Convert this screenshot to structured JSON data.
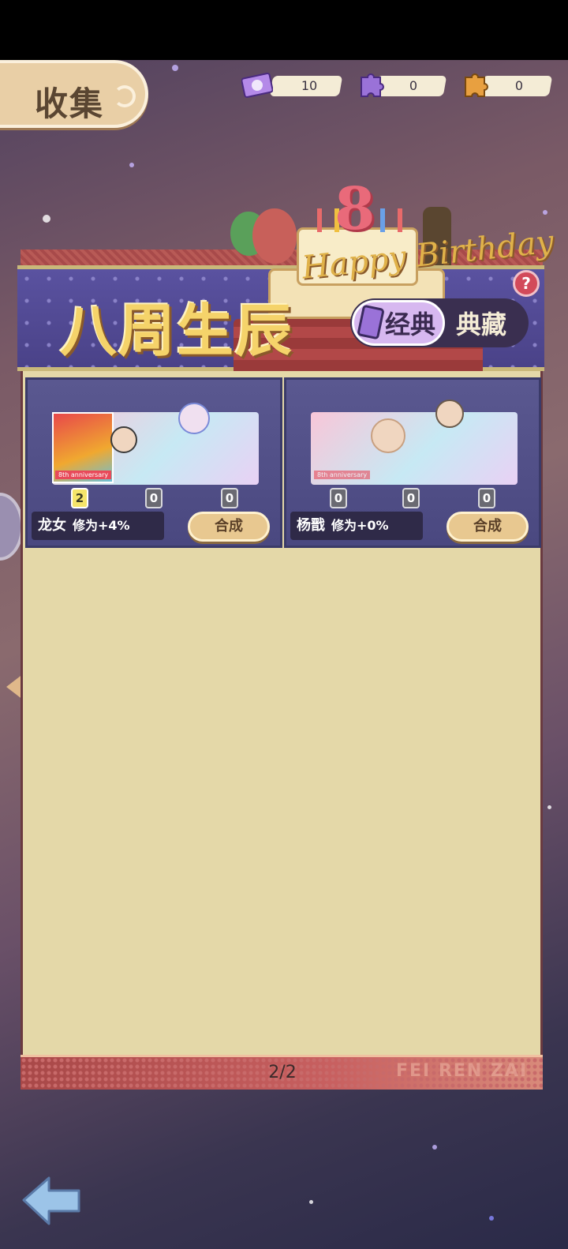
{
  "header": {
    "title": "收集"
  },
  "resources": [
    {
      "icon": "ticket-icon",
      "value": "10"
    },
    {
      "icon": "purple-puzzle-icon",
      "value": "0"
    },
    {
      "icon": "orange-puzzle-icon",
      "value": "0"
    }
  ],
  "banner": {
    "title": "八周生辰",
    "tabs": [
      "经典",
      "典藏"
    ],
    "selected_tab": "经典",
    "help_label": "?"
  },
  "cards": [
    {
      "name": "龙女",
      "bonus": "修为+4%",
      "counts": [
        "2",
        "0",
        "0"
      ],
      "owned_index": 0,
      "button": "合成",
      "tag": "8th anniversary"
    },
    {
      "name": "杨戬",
      "bonus": "修为+0%",
      "counts": [
        "0",
        "0",
        "0"
      ],
      "owned_index": -1,
      "button": "合成",
      "tag": "8th anniversary"
    }
  ],
  "footer": {
    "page": "2/2",
    "watermark": "FEI REN ZAI"
  },
  "colors": {
    "accent_gold": "#f5d36a",
    "panel_bg": "#e4d8a8",
    "card_bg": "#4a4880"
  }
}
